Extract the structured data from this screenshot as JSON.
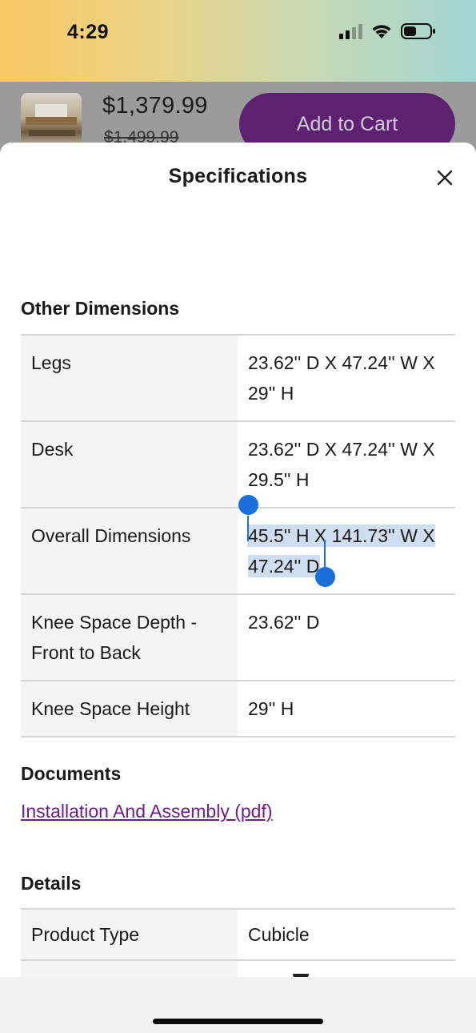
{
  "status_bar": {
    "time": "4:29"
  },
  "product": {
    "price": "$1,379.99",
    "old_price": "$1,499.99",
    "add_to_cart_label": "Add to Cart"
  },
  "sheet": {
    "title": "Specifications"
  },
  "other_dimensions": {
    "heading": "Other Dimensions",
    "rows": [
      {
        "label": "Legs",
        "value": "23.62'' D X 47.24'' W X 29'' H"
      },
      {
        "label": "Desk",
        "value": "23.62'' D X 47.24'' W X 29.5'' H"
      },
      {
        "label": "Overall Dimensions",
        "value": "45.5'' H X 141.73'' W X 47.24'' D"
      },
      {
        "label": "Knee Space Depth - Front to Back",
        "value": "23.62'' D"
      },
      {
        "label": "Knee Space Height",
        "value": "29'' H"
      }
    ]
  },
  "documents": {
    "heading": "Documents",
    "link_label": "Installation And Assembly (pdf)"
  },
  "details": {
    "heading": "Details",
    "rows": [
      {
        "label": "Product Type",
        "value": "Cubicle"
      }
    ]
  },
  "colors": {
    "accent_purple": "#5c2270",
    "link_purple": "#6b1f8a",
    "selection_blue": "#1b6fdc"
  }
}
